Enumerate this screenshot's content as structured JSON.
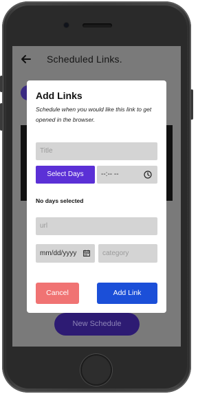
{
  "appbar": {
    "title": "Scheduled Links."
  },
  "background": {
    "new_schedule_label": "New Schedule"
  },
  "dialog": {
    "title": "Add Links",
    "subtitle": "Schedule when you would like this link to get opened in the browser.",
    "title_placeholder": "Title",
    "select_days_label": "Select Days",
    "time_value": "--:-- --",
    "days_status": "No days selected",
    "url_placeholder": "url",
    "date_value": "mm/dd/yyyy",
    "category_placeholder": "category",
    "cancel_label": "Cancel",
    "add_label": "Add Link"
  },
  "colors": {
    "primary_purple": "#5b30d6",
    "add_blue": "#1b4fd8",
    "cancel_red": "#f07373",
    "overlay_gray": "#7a7a7a"
  },
  "icons": [
    "back-arrow-icon",
    "clock-icon",
    "calendar-icon"
  ]
}
